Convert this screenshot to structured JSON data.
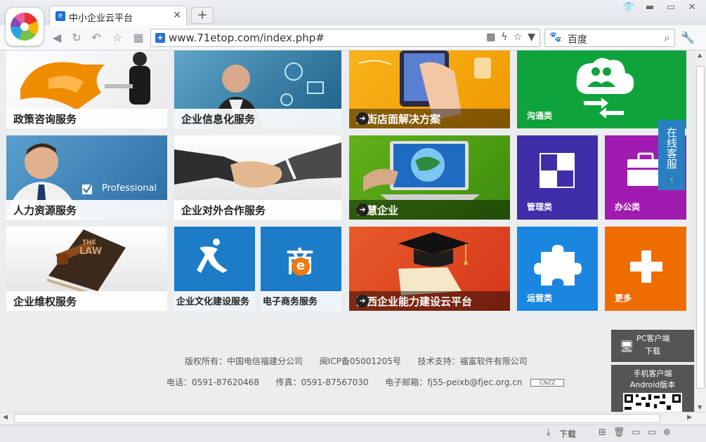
{
  "browser": {
    "tab_title": "中小企业云平台",
    "new_tab": "+",
    "url": "www.71etop.com/index.php#",
    "search_engine_label": "百度",
    "window_buttons": [
      "shirt-icon",
      "minimize",
      "maximize",
      "close"
    ]
  },
  "tiles": {
    "policy": "政策咨询服务",
    "informatization": "企业信息化服务",
    "store": "沿街店面解决方案",
    "hr": "人力资源服务",
    "hr_badge": "Professional",
    "cooperation": "企业对外合作服务",
    "smart": "智慧企业",
    "rights": "企业维权服务",
    "culture": "企业文化建设服务",
    "ecommerce": "电子商务服务",
    "capability": "海西企业能力建设云平台",
    "law_book": "LAW",
    "law_book_prefix": "THE",
    "ecommerce_char": "商",
    "ecommerce_e": "e"
  },
  "metro": {
    "communication": "沟通类",
    "management": "管理类",
    "office": "办公类",
    "operation": "运营类",
    "more": "更多"
  },
  "side": {
    "chat": "在线客服",
    "pc_client_line1": "PC客户端",
    "pc_client_line2": "下载",
    "mobile_line1": "手机客户端",
    "mobile_line2": "Android版本"
  },
  "footer": {
    "copyright": "版权所有：中国电信福建分公司",
    "icp": "闽ICP备05001205号",
    "support": "技术支持：福富软件有限公司",
    "phone": "电话：0591-87620468",
    "fax": "传真：0591-87567030",
    "email": "电子邮箱：fj55-peixb@fjec.org.cn",
    "cnzz": "CNZZ"
  },
  "status": {
    "download": "下载"
  },
  "colors": {
    "green": "#0fa33b",
    "purple": "#a21bb0",
    "indigo": "#3e2ea8",
    "blue": "#1a86df",
    "orange": "#ef6c00",
    "red": "#e0411c",
    "brand_blue": "#2a7fc1"
  }
}
